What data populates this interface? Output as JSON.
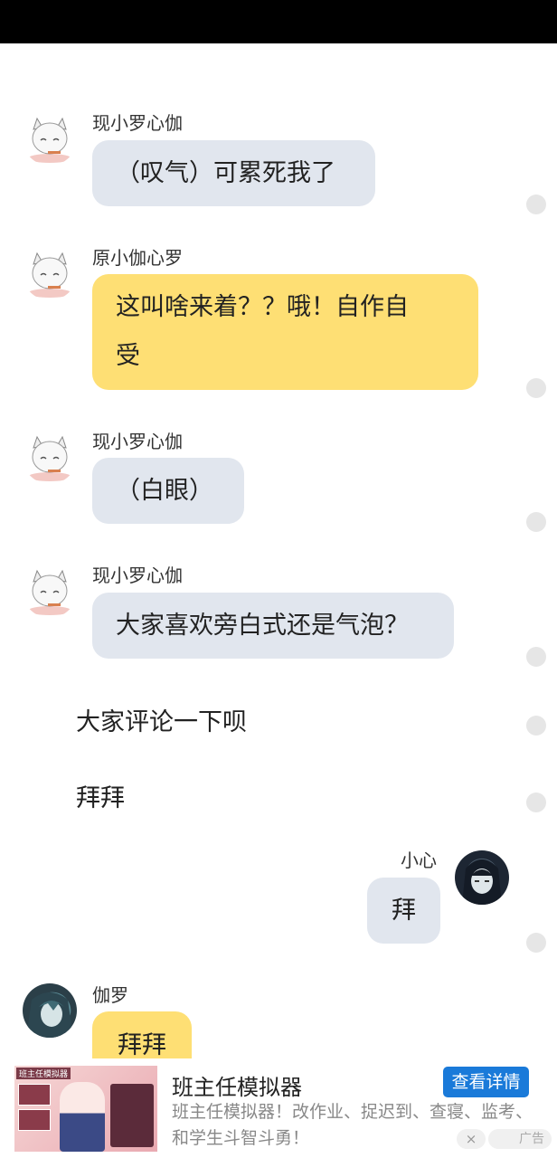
{
  "messages": [
    {
      "name": "现小罗心伽",
      "text": "（叹气）可累死我了"
    },
    {
      "name": "原小伽心罗",
      "line1": "这叫啥来着？？哦！自作自",
      "line2": "受"
    },
    {
      "name": "现小罗心伽",
      "text": "（白眼）"
    },
    {
      "name": "现小罗心伽",
      "text": "大家喜欢旁白式还是气泡？"
    }
  ],
  "narration": [
    "大家评论一下呗",
    "拜拜"
  ],
  "reply_right": {
    "name": "小心",
    "text": "拜"
  },
  "reply_left": {
    "name": "伽罗",
    "text": "拜拜"
  },
  "ad": {
    "title": "班主任模拟器",
    "description": "班主任模拟器！改作业、捉迟到、查寝、监考、和学生斗智斗勇！",
    "button": "查看详情",
    "badge": "广告",
    "close_icon": "×",
    "image_title": "班主任模拟器"
  },
  "icons": {
    "avatar_cat": "white-cat-girl-avatar",
    "avatar_dark": "dark-hair-avatar",
    "avatar_teal": "teal-hair-avatar"
  }
}
